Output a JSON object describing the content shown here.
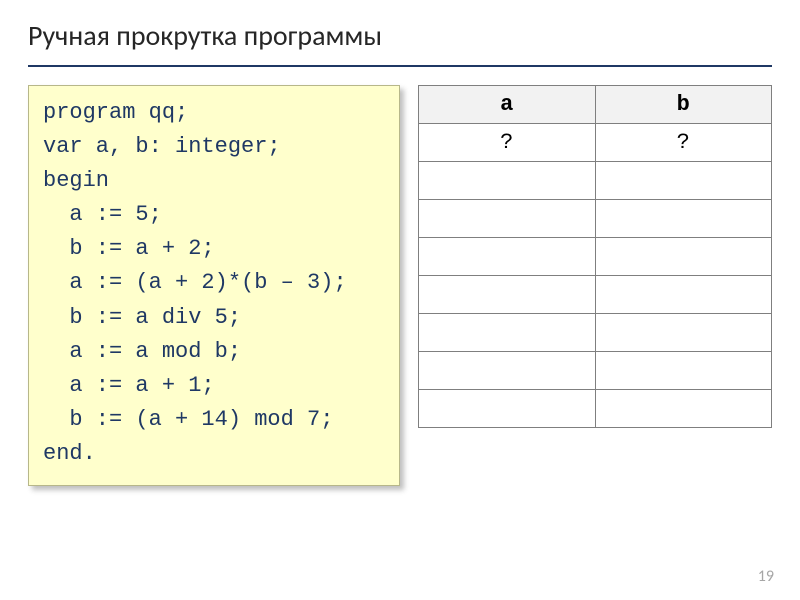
{
  "title": "Ручная прокрутка программы",
  "code": [
    "program qq;",
    "var a, b: integer;",
    "begin",
    "  a := 5;",
    "  b := a + 2;",
    "  a := (a + 2)*(b – 3);",
    "  b := a div 5;",
    "  a := a mod b;",
    "  a := a + 1;",
    "  b := (a + 14) mod 7;",
    "end."
  ],
  "table": {
    "headers": [
      "a",
      "b"
    ],
    "rows": [
      [
        "?",
        "?"
      ],
      [
        "",
        ""
      ],
      [
        "",
        ""
      ],
      [
        "",
        ""
      ],
      [
        "",
        ""
      ],
      [
        "",
        ""
      ],
      [
        "",
        ""
      ],
      [
        "",
        ""
      ]
    ]
  },
  "page_number": "19"
}
